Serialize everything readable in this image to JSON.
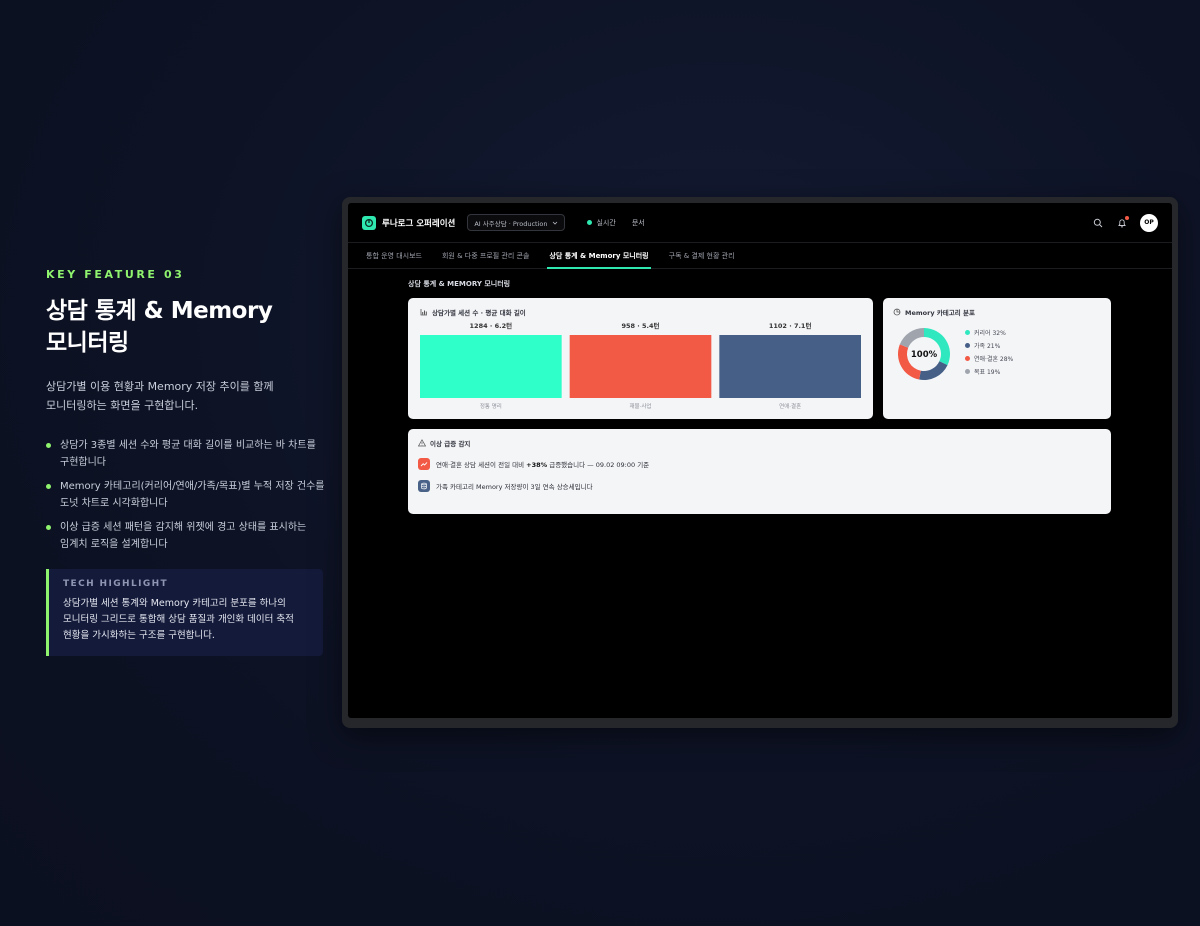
{
  "left": {
    "eyebrow": "KEY FEATURE 03",
    "title": "상담 통계 & Memory\n모니터링",
    "description": "상담가별 이용 현황과 Memory 저장 추이를 함께\n모니터링하는 화면을 구현합니다.",
    "bullets": [
      "상담가 3종별 세션 수와 평균 대화 길이를 비교하는 바 차트를\n구현합니다",
      "Memory 카테고리(커리어/연애/가족/목표)별 누적 저장 건수를\n도넛 차트로 시각화합니다",
      "이상 급증 세션 패턴을 감지해 위젯에 경고 상태를 표시하는\n임계치 로직을 설계합니다"
    ],
    "tech_label": "TECH HIGHLIGHT",
    "tech_text": "상담가별 세션 통계와 Memory 카테고리 분포를 하나의\n모니터링 그리드로 통합해 상담 품질과 개인화 데이터 축적\n현황을 가시화하는 구조를 구현합니다."
  },
  "app": {
    "title": "루나로그 오퍼레이션",
    "env_select": "AI 사주상담 · Production",
    "live_label": "실시간",
    "docs_label": "문서",
    "avatar": "OP",
    "tabs": [
      {
        "label": "통합 운영 대시보드",
        "active": false
      },
      {
        "label": "회원 & 다중 프로필 관리 콘솔",
        "active": false
      },
      {
        "label": "상담 통계 & Memory 모니터링",
        "active": true
      },
      {
        "label": "구독 & 결제 현황 관리",
        "active": false
      }
    ],
    "section_title": "상담 통계 & MEMORY 모니터링",
    "bar_card_title": "상담가별 세션 수 · 평균 대화 길이",
    "donut_card_title": "Memory 카테고리 분포",
    "donut_center": "100%",
    "alert_card_title": "이상 급증 감지",
    "alerts": [
      {
        "before": "연애·결혼 상담 세션이 전일 대비 ",
        "strong": "+38%",
        "after": " 급증했습니다 — 09.02 09:00 기준",
        "color": "#f25a45"
      },
      {
        "before": "가족 카테고리 Memory 저장량이 3일 연속 상승세입니다",
        "strong": "",
        "after": "",
        "color": "#4a6288"
      }
    ]
  },
  "chart_data": [
    {
      "type": "bar",
      "title": "상담가별 세션 수 · 평균 대화 길이",
      "categories": [
        "정통 명리",
        "재물·사업",
        "연애·결혼"
      ],
      "bar_labels": [
        "1284 · 6.2턴",
        "958 · 5.4턴",
        "1102 · 7.1턴"
      ],
      "values": [
        1284,
        958,
        1102
      ],
      "colors": [
        "#2fffc9",
        "#f25a45",
        "#455f87"
      ]
    },
    {
      "type": "pie",
      "title": "Memory 카테고리 분포",
      "labels": [
        "커리어",
        "가족",
        "연애·결혼",
        "목표"
      ],
      "values": [
        32,
        21,
        28,
        19
      ],
      "legend": [
        "커리어 32%",
        "가족 21%",
        "연애·결혼 28%",
        "목표 19%"
      ],
      "colors": [
        "#2fe8c0",
        "#455f87",
        "#f25a45",
        "#9fa4ad"
      ],
      "legend_position": "right"
    }
  ]
}
